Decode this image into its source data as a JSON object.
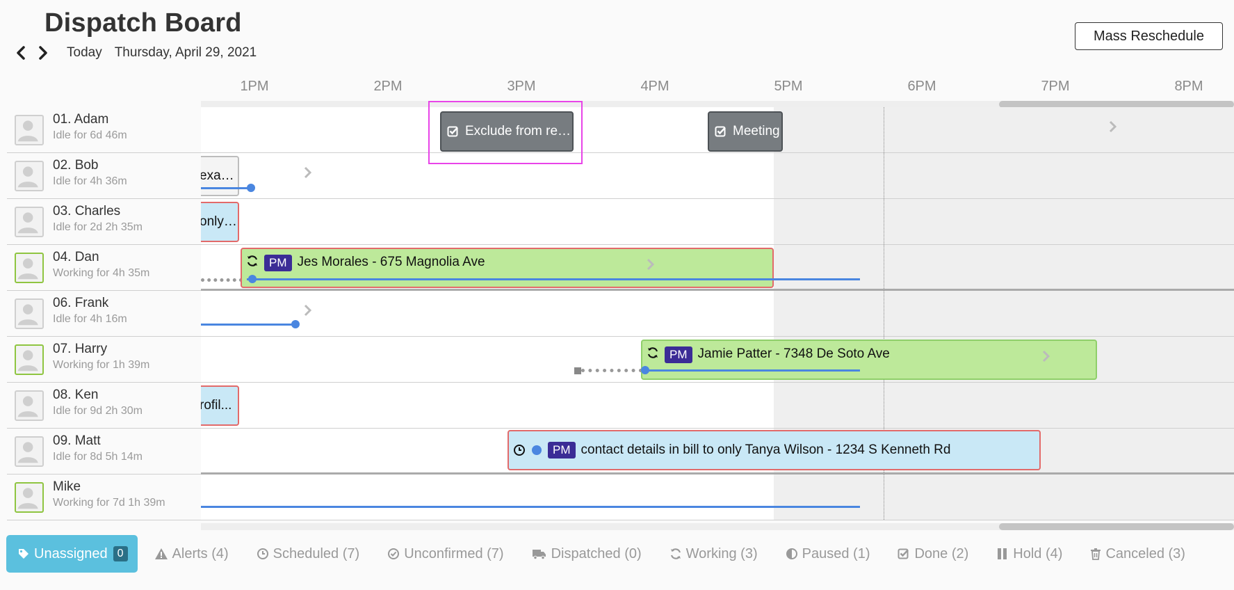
{
  "header": {
    "title": "Dispatch Board",
    "today_label": "Today",
    "date": "Thursday, April 29, 2021",
    "mass_reschedule_label": "Mass Reschedule"
  },
  "timeline": {
    "hours": [
      "1PM",
      "2PM",
      "3PM",
      "4PM",
      "5PM",
      "6PM",
      "7PM",
      "8PM"
    ]
  },
  "resources": [
    {
      "name": "01. Adam",
      "status": "Idle for 6d 46m",
      "state": "idle"
    },
    {
      "name": "02. Bob",
      "status": "Idle for 4h 36m",
      "state": "idle"
    },
    {
      "name": "03. Charles",
      "status": "Idle for 2d 2h 35m",
      "state": "idle"
    },
    {
      "name": "04. Dan",
      "status": "Working for 4h 35m",
      "state": "working"
    },
    {
      "name": "06. Frank",
      "status": "Idle for 4h 16m",
      "state": "idle"
    },
    {
      "name": "07. Harry",
      "status": "Working for 1h 39m",
      "state": "working"
    },
    {
      "name": "08. Ken",
      "status": "Idle for 9d 2h 30m",
      "state": "idle"
    },
    {
      "name": "09. Matt",
      "status": "Idle for 8d 5h 14m",
      "state": "idle"
    },
    {
      "name": "Mike",
      "status": "Working for 7d 1h 39m",
      "state": "working"
    }
  ],
  "jobs": {
    "adam_1": "Exclude from repo",
    "adam_2": "Meeting",
    "bob_1": "exan...",
    "charles_1": "only ...",
    "dan_1": "Jes Morales - 675 Magnolia Ave",
    "harry_1": "Jamie Patter - 7348 De Soto Ave",
    "ken_1": "rofil...",
    "matt_1": "contact details in bill to only Tanya Wilson - 1234 S Kenneth Rd",
    "pm_badge": "PM"
  },
  "tabs": {
    "unassigned": {
      "label": "Unassigned",
      "count": "0"
    },
    "alerts": "Alerts (4)",
    "scheduled": "Scheduled (7)",
    "unconfirmed": "Unconfirmed (7)",
    "dispatched": "Dispatched (0)",
    "working": "Working (3)",
    "paused": "Paused (1)",
    "done": "Done (2)",
    "hold": "Hold (4)",
    "canceled": "Canceled (3)"
  },
  "colors": {
    "working_job": "#bde99a",
    "scheduled_job": "#c9e8f6",
    "personal_event": "#777c80",
    "pm_badge": "#3b2c96",
    "route": "#4a86e0",
    "alert_border": "#e26a6a",
    "active_tab": "#5bc0de"
  }
}
